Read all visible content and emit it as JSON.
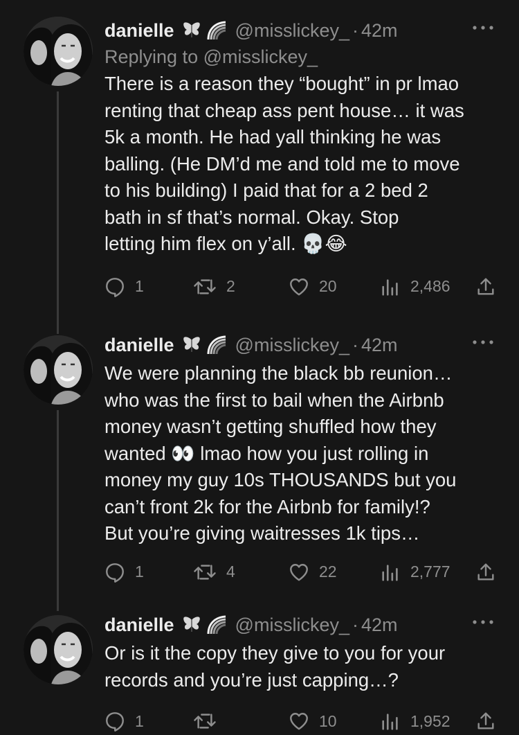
{
  "colors": {
    "background": "#161616",
    "text": "#ececec",
    "muted": "#8e8e8e",
    "thread_line": "#3a3a3a"
  },
  "tweets": [
    {
      "name": "danielle",
      "badges": [
        "butterfly-icon",
        "rainbow-icon"
      ],
      "handle": "@misslickey_",
      "separator": "·",
      "time": "42m",
      "replying_to": "Replying to @misslickey_",
      "text": "There is a reason they “bought” in pr lmao\nrenting that cheap ass pent house… it was\n5k a month. He had yall thinking he was\nballing. (He DM’d me and told me to move\nto his building) I paid that for a 2 bed 2\nbath in sf that’s normal. Okay. Stop\nletting him flex on y’all. 💀😂",
      "replies": "1",
      "retweets": "2",
      "likes": "20",
      "views": "2,486"
    },
    {
      "name": "danielle",
      "badges": [
        "butterfly-icon",
        "rainbow-icon"
      ],
      "handle": "@misslickey_",
      "separator": "·",
      "time": "42m",
      "replying_to": "",
      "text": "We were planning the black bb reunion…\nwho was the first to bail when the Airbnb\nmoney wasn’t getting shuffled how they\nwanted 👀 lmao how you just rolling in\nmoney my guy 10s THOUSANDS but you\ncan’t front 2k for the Airbnb for family!?\nBut you’re giving waitresses 1k tips…",
      "replies": "1",
      "retweets": "4",
      "likes": "22",
      "views": "2,777"
    },
    {
      "name": "danielle",
      "badges": [
        "butterfly-icon",
        "rainbow-icon"
      ],
      "handle": "@misslickey_",
      "separator": "·",
      "time": "42m",
      "replying_to": "",
      "text": "Or is it the copy they give to you for your\nrecords and you’re just capping…?",
      "replies": "1",
      "retweets": "",
      "likes": "10",
      "views": "1,952"
    }
  ]
}
